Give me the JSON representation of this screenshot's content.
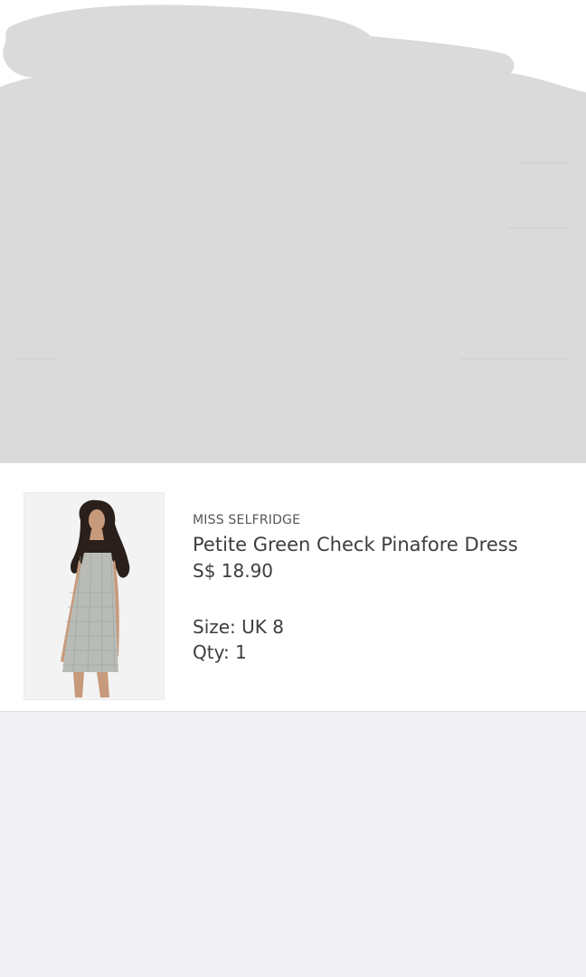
{
  "order_item": {
    "brand": "MISS SELFRIDGE",
    "name": "Petite Green Check Pinafore Dress",
    "price": "S$ 18.90",
    "size": "Size: UK 8",
    "qty": "Qty: 1",
    "image_icon": "product-photo-dress"
  },
  "colors": {
    "redaction_gray": "#dadada",
    "page_background": "#efeff4",
    "card_background": "#ffffff"
  }
}
